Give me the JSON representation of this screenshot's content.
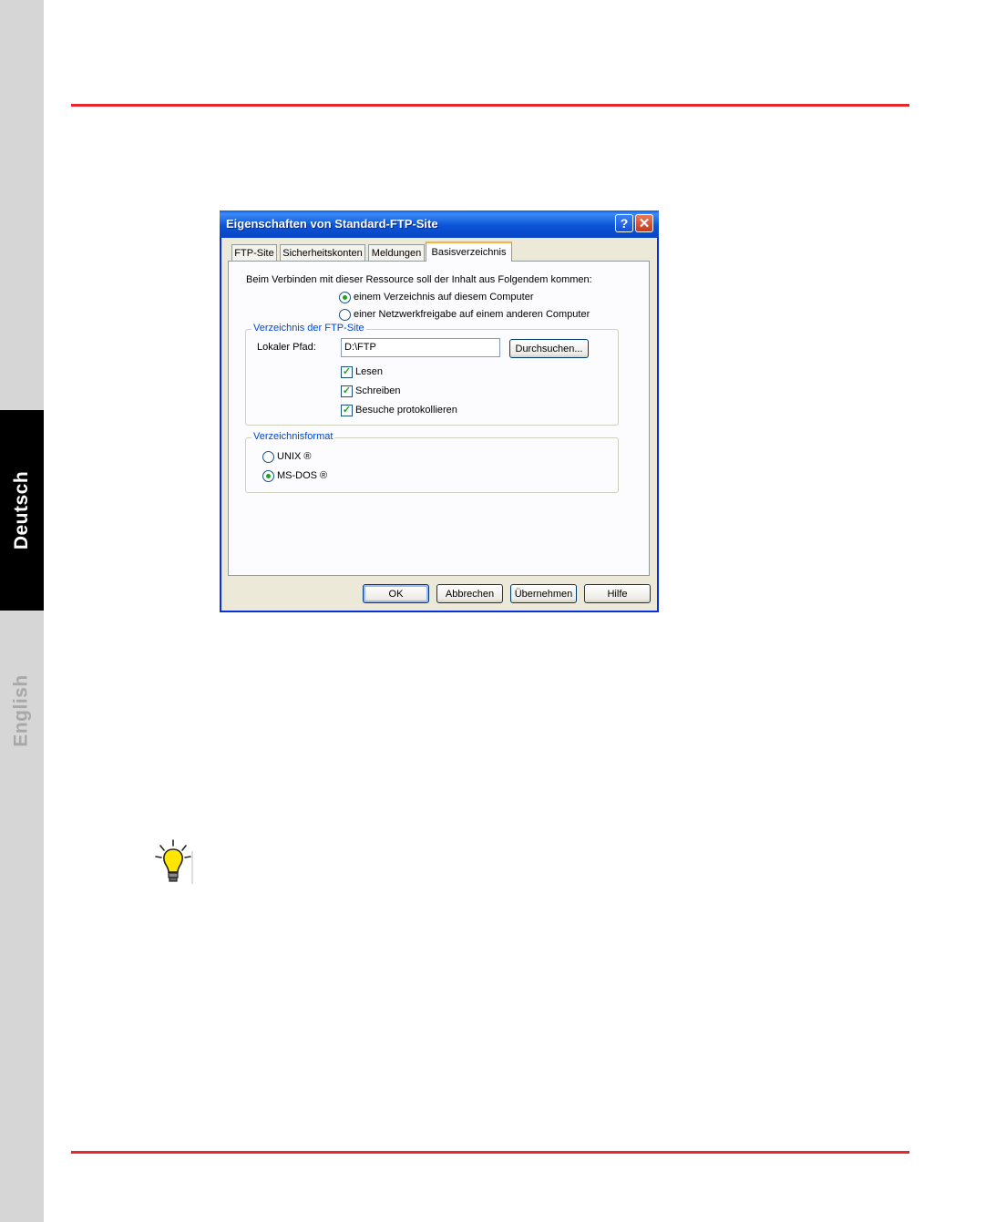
{
  "side_tabs": {
    "deutsch": "Deutsch",
    "english": "English"
  },
  "colors": {
    "rule": "#e8262b",
    "side_active": "#000000",
    "side_inactive": "#a8a8a8",
    "xp_title": "#0b54d8"
  },
  "dialog": {
    "title": "Eigenschaften von Standard-FTP-Site",
    "tabs": [
      {
        "label": "FTP-Site"
      },
      {
        "label": "Sicherheitskonten"
      },
      {
        "label": "Meldungen"
      },
      {
        "label": "Basisverzeichnis",
        "active": true
      }
    ],
    "intro": "Beim Verbinden mit dieser Ressource soll der Inhalt aus Folgendem kommen:",
    "source_options": [
      {
        "label": "einem Verzeichnis auf diesem Computer",
        "selected": true
      },
      {
        "label": "einer Netzwerkfreigabe auf einem anderen Computer",
        "selected": false
      }
    ],
    "dir_group": {
      "legend": "Verzeichnis der FTP-Site",
      "path_label": "Lokaler Pfad:",
      "path_value": "D:\\FTP",
      "browse": "Durchsuchen...",
      "checks": [
        {
          "label": "Lesen",
          "checked": true
        },
        {
          "label": "Schreiben",
          "checked": true
        },
        {
          "label": "Besuche protokollieren",
          "checked": true
        }
      ]
    },
    "format_group": {
      "legend": "Verzeichnisformat",
      "options": [
        {
          "label": "UNIX ®",
          "selected": false
        },
        {
          "label": "MS-DOS ®",
          "selected": true
        }
      ]
    },
    "buttons": {
      "ok": "OK",
      "cancel": "Abbrechen",
      "apply": "Übernehmen",
      "help": "Hilfe"
    }
  },
  "icons": {
    "tip": "lightbulb-icon",
    "help": "help-icon",
    "close": "close-icon"
  }
}
